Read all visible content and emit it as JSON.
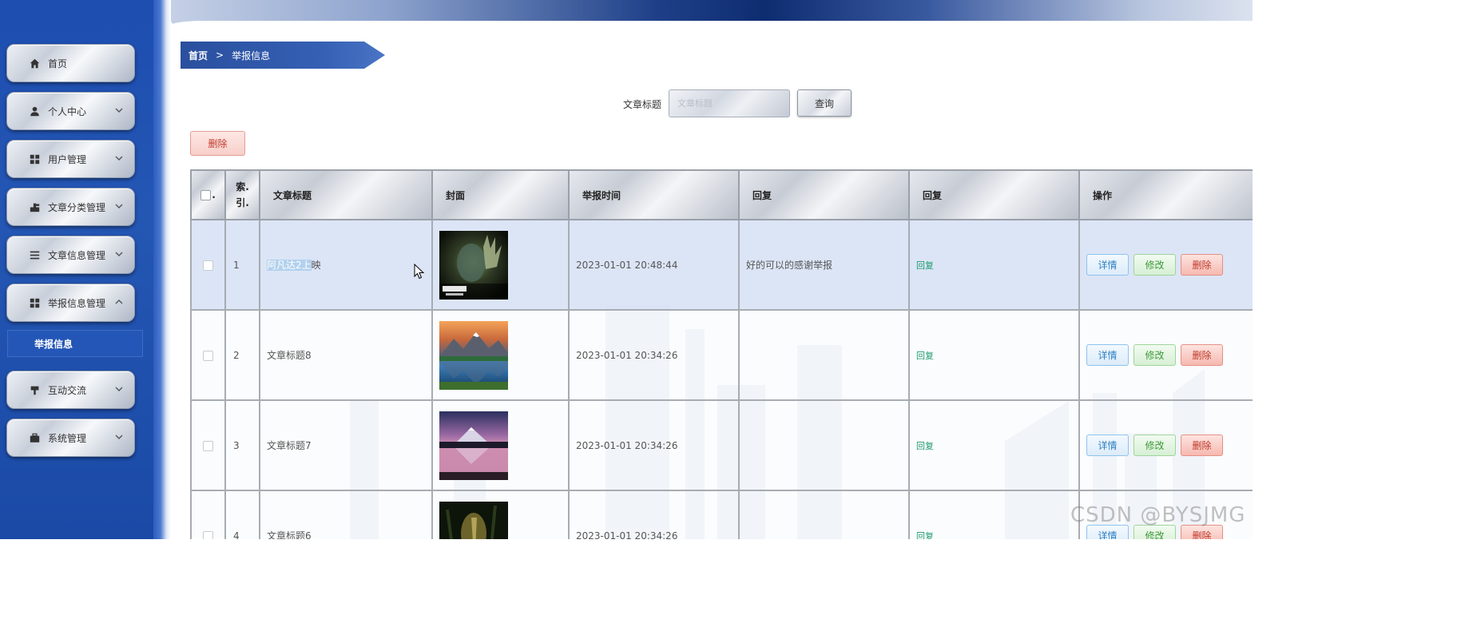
{
  "sidebar": {
    "items": [
      {
        "label": "首页",
        "icon": "home-icon",
        "has_chevron": false
      },
      {
        "label": "个人中心",
        "icon": "user-icon",
        "has_chevron": true
      },
      {
        "label": "用户管理",
        "icon": "grid-icon",
        "has_chevron": true
      },
      {
        "label": "文章分类管理",
        "icon": "stamp-icon",
        "has_chevron": true
      },
      {
        "label": "文章信息管理",
        "icon": "list-icon",
        "has_chevron": true
      },
      {
        "label": "举报信息管理",
        "icon": "grid-icon",
        "has_chevron": true,
        "expanded": true
      },
      {
        "label": "互动交流",
        "icon": "podium-icon",
        "has_chevron": true
      },
      {
        "label": "系统管理",
        "icon": "briefcase-icon",
        "has_chevron": true
      }
    ],
    "sub_active": "举报信息"
  },
  "breadcrumb": {
    "home": "首页",
    "separator": ">",
    "current": "举报信息"
  },
  "search": {
    "label": "文章标题",
    "placeholder": "文章标题",
    "value": "",
    "button": "查询"
  },
  "actions": {
    "batch_delete": "删除"
  },
  "table": {
    "header_checkbox_suffix": ".",
    "columns": [
      "索.引.",
      "文章标题",
      "封面",
      "举报时间",
      "回复",
      "回复",
      "操作"
    ],
    "rows": [
      {
        "index": "1",
        "title_highlight": "阿凡达2上",
        "title_rest": "映",
        "cover": "avatar-poster",
        "time": "2023-01-01 20:48:44",
        "reply_text": "好的可以的感谢举报",
        "reply_link": "回复",
        "selected": true
      },
      {
        "index": "2",
        "title_highlight": "",
        "title_rest": "文章标题8",
        "cover": "mountain-lake",
        "time": "2023-01-01 20:34:26",
        "reply_text": "",
        "reply_link": "回复",
        "selected": false
      },
      {
        "index": "3",
        "title_highlight": "",
        "title_rest": "文章标题7",
        "cover": "sunset-lake",
        "time": "2023-01-01 20:34:26",
        "reply_text": "",
        "reply_link": "回复",
        "selected": false
      },
      {
        "index": "4",
        "title_highlight": "",
        "title_rest": "文章标题6",
        "cover": "forest-night",
        "time": "2023-01-01 20:34:26",
        "reply_text": "",
        "reply_link": "回复",
        "selected": false
      }
    ],
    "ops": {
      "detail": "详情",
      "edit": "修改",
      "delete": "删除"
    }
  },
  "watermark": "CSDN @BYSJMG",
  "colors": {
    "sidebar": "#1d4eb0",
    "breadcrumb": "#3560b4",
    "delete": "#c0392b",
    "reply_link": "#1e9b6e",
    "selected_row": "#d6e1f4"
  }
}
